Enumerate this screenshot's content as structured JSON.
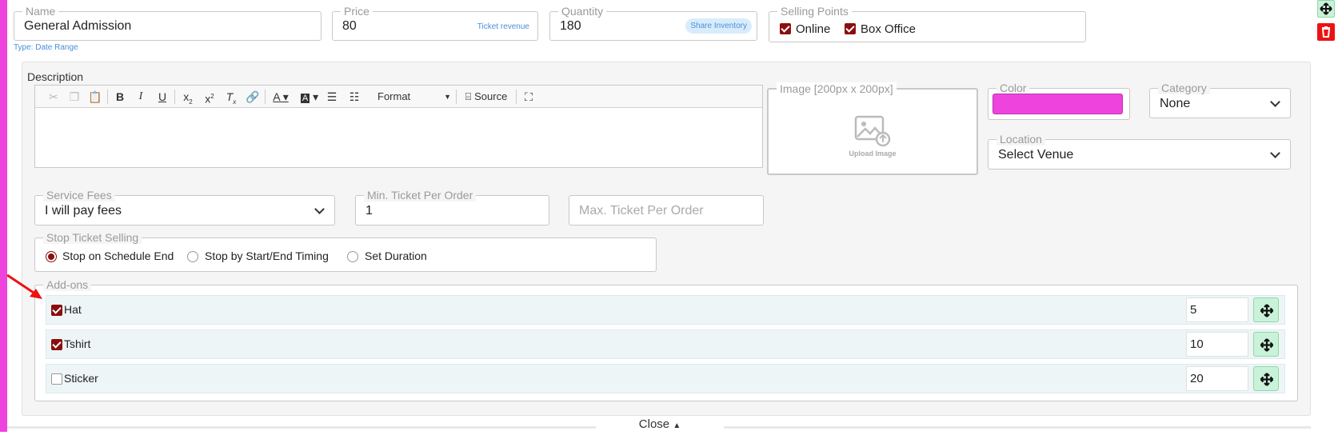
{
  "colors": {
    "accent": "#ee44dd",
    "brand_dark_red": "#8b0e0e",
    "side_green": "#c9f3d8",
    "side_red": "#ee1111"
  },
  "ticket": {
    "name": {
      "label": "Name",
      "value": "General Admission",
      "type_hint": "Type: Date Range"
    },
    "price": {
      "label": "Price",
      "value": "80",
      "badge": "Ticket revenue"
    },
    "quantity": {
      "label": "Quantity",
      "value": "180",
      "badge": "Share Inventory"
    },
    "selling_points": {
      "label": "Selling Points",
      "options": [
        {
          "label": "Online",
          "checked": true
        },
        {
          "label": "Box Office",
          "checked": true
        }
      ]
    }
  },
  "description": {
    "label": "Description",
    "toolbar": {
      "format_label": "Format",
      "source_label": "Source"
    }
  },
  "image": {
    "label": "Image [200px x 200px]",
    "upload_label": "Upload Image"
  },
  "color": {
    "label": "Color",
    "value": "#ee44dd"
  },
  "category": {
    "label": "Category",
    "value": "None"
  },
  "location": {
    "label": "Location",
    "value": "Select Venue"
  },
  "service_fees": {
    "label": "Service Fees",
    "value": "I will pay fees"
  },
  "min_ticket": {
    "label": "Min. Ticket Per Order",
    "value": "1"
  },
  "max_ticket": {
    "placeholder": "Max. Ticket Per Order"
  },
  "stop_selling": {
    "label": "Stop Ticket Selling",
    "options": [
      {
        "label": "Stop on Schedule End",
        "selected": true
      },
      {
        "label": "Stop by Start/End Timing",
        "selected": false
      },
      {
        "label": "Set Duration",
        "selected": false
      }
    ]
  },
  "addons": {
    "label": "Add-ons",
    "items": [
      {
        "label": "Hat",
        "checked": true,
        "quantity": "5"
      },
      {
        "label": "Tshirt",
        "checked": true,
        "quantity": "10"
      },
      {
        "label": "Sticker",
        "checked": false,
        "quantity": "20"
      }
    ]
  },
  "footer": {
    "close_label": "Close"
  }
}
